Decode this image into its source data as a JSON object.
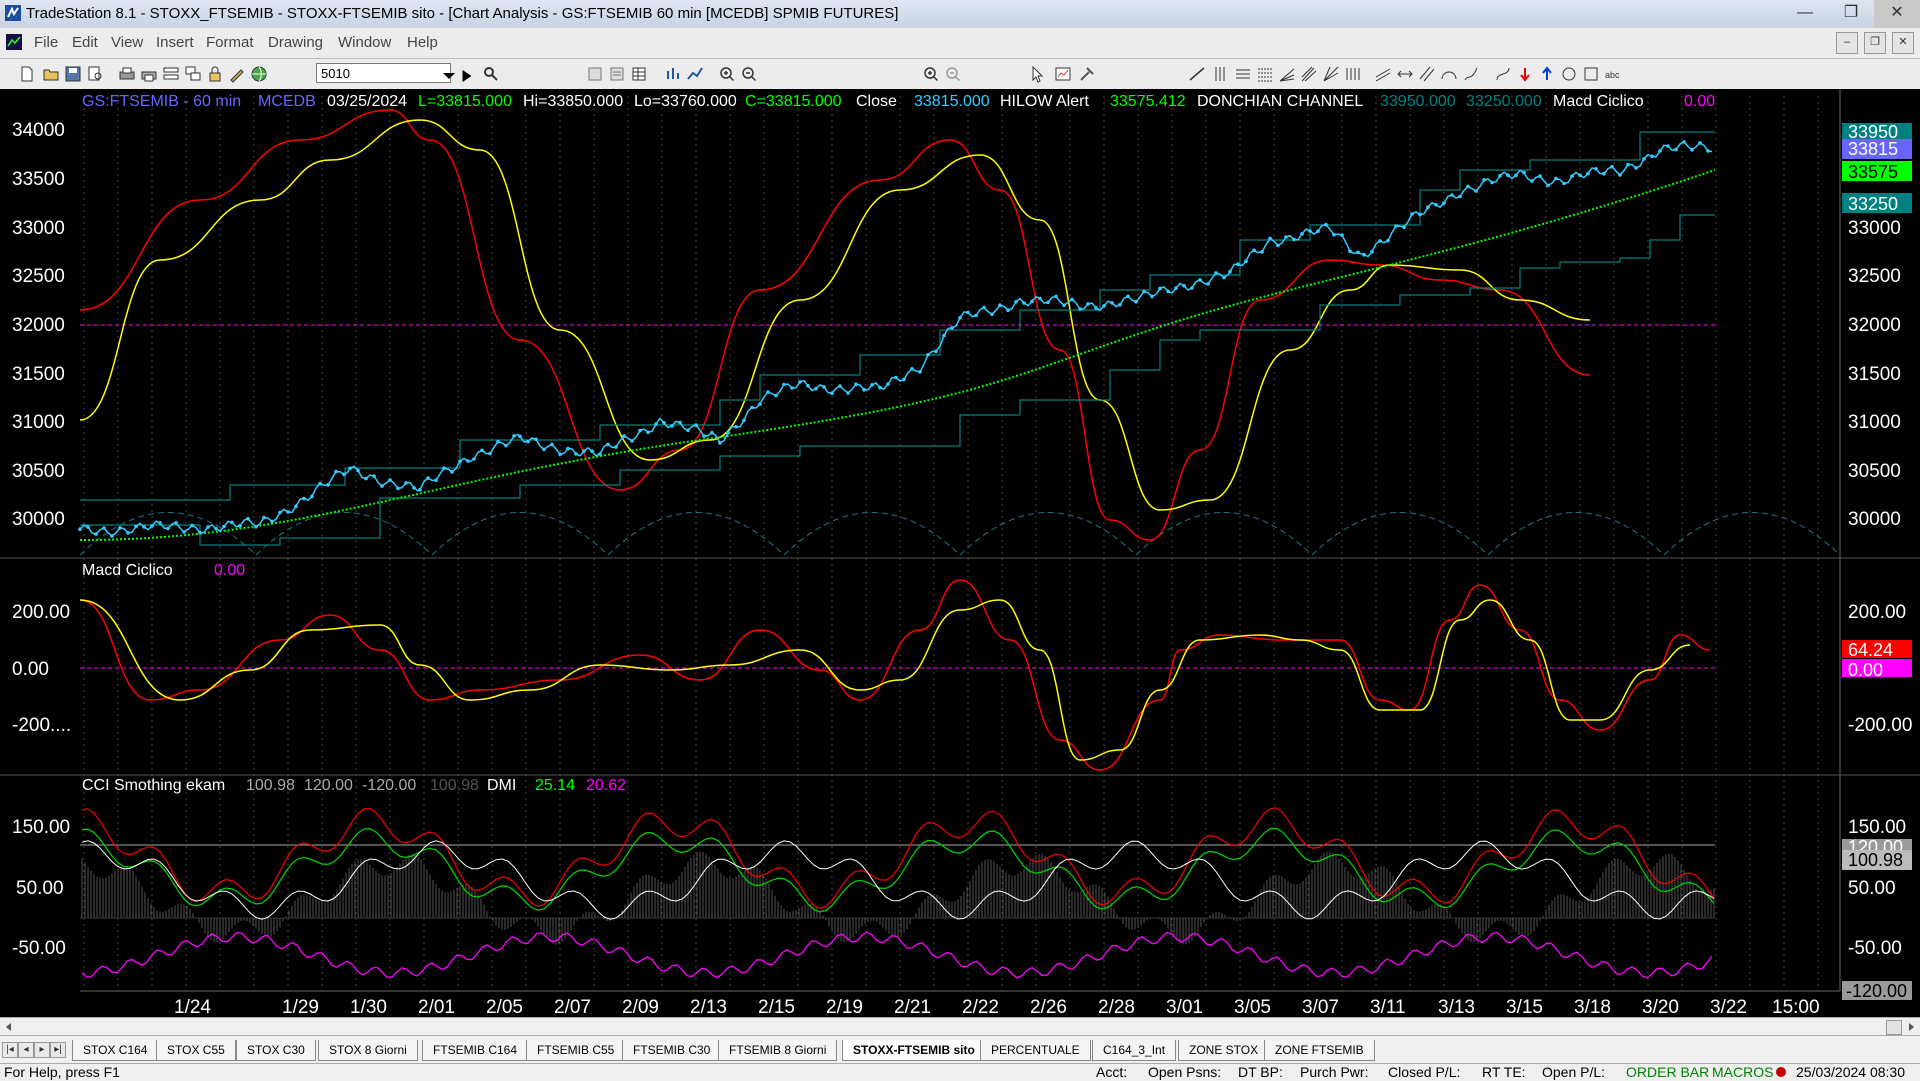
{
  "window": {
    "title": "TradeStation 8.1 - STOXX_FTSEMIB - STOXX-FTSEMIB sito - [Chart Analysis - GS:FTSEMIB  60 min  [MCEDB] SPMIB FUTURES]",
    "minimize": "—",
    "restore": "❐",
    "close": "✕"
  },
  "menu": [
    "File",
    "Edit",
    "View",
    "Insert",
    "Format",
    "Drawing",
    "Window",
    "Help"
  ],
  "mdi_buttons": [
    "–",
    "❐",
    "✕"
  ],
  "toolbar": {
    "symbol_value": "5010"
  },
  "chart": {
    "price_header": {
      "symbol": "GS:FTSEMIB - 60 min",
      "feed": "MCEDB",
      "date": "03/25/2024",
      "last": "L=33815.000",
      "hi": "Hi=33850.000",
      "lo": "Lo=33760.000",
      "close_c": "C=33815.000",
      "close_label": "Close",
      "close_value": "33815.000",
      "hilow_label": "HILOW Alert",
      "hilow_value": "33575.412",
      "donchian_label": "DONCHIAN CHANNEL",
      "donchian_hi": "33950.000",
      "donchian_lo": "33250.000",
      "macd_label": "Macd Ciclico",
      "macd_value": "0.00"
    },
    "price_axis": [
      "34000",
      "33500",
      "33000",
      "32500",
      "32000",
      "31500",
      "31000",
      "30500",
      "30000"
    ],
    "price_axis_right": [
      "33000",
      "32500",
      "32000",
      "31500",
      "31000",
      "30500",
      "30000"
    ],
    "price_tags": [
      {
        "text": "33950",
        "color": "#008080"
      },
      {
        "text": "33815",
        "color": "#6666ff"
      },
      {
        "text": "33575",
        "color": "#00ff00"
      },
      {
        "text": "33250",
        "color": "#008080"
      }
    ],
    "macd_panel": {
      "label": "Macd Ciclico",
      "value": "0.00",
      "axis": [
        "200.00",
        "0.00",
        "-200...."
      ],
      "axis_right": [
        "200.00",
        "-200.00"
      ],
      "tags": [
        {
          "text": "64.24",
          "color": "#ff0000"
        },
        {
          "text": "0.00",
          "color": "#ff00ff"
        }
      ]
    },
    "cci_panel": {
      "label": "CCI Smothing ekam",
      "v1": "100.98",
      "v2": "120.00",
      "v3": "-120.00",
      "v4": "100.98",
      "dmi_label": "DMI",
      "dmi_plus": "25.14",
      "dmi_minus": "20.62",
      "axis": [
        "150.00",
        "50.00",
        "-50.00"
      ],
      "axis_right": [
        "150.00",
        "50.00",
        "-50.00"
      ],
      "tags": [
        {
          "text": "120.00",
          "color": "#bbbbbb"
        },
        {
          "text": "100.98",
          "color": "#ffffff"
        },
        {
          "text": "-120.00",
          "color": "#bbbbbb"
        }
      ]
    },
    "date_axis": [
      "1/24",
      "1/29",
      "1/30",
      "2/01",
      "2/05",
      "2/07",
      "2/09",
      "2/13",
      "2/15",
      "2/19",
      "2/21",
      "2/22",
      "2/26",
      "2/28",
      "3/01",
      "3/05",
      "3/07",
      "3/11",
      "3/13",
      "3/15",
      "3/18",
      "3/20",
      "3/22",
      "15:00"
    ],
    "colors": {
      "price": "#33ccff",
      "hilow": "#00ff00",
      "donchian": "#008080",
      "red": "#ff0000",
      "yellow": "#ffff00",
      "magenta": "#ff00ff",
      "cci_green": "#00cc00",
      "cci_red": "#ff0000",
      "cci_white": "#ffffff"
    }
  },
  "tabs": [
    "STOX C164",
    "STOX C55",
    "STOX  C30",
    "STOX  8 Giorni",
    "FTSEMIB C164",
    "FTSEMIB C55",
    "FTSEMIB C30",
    "FTSEMIB  8 Giorni",
    "STOXX-FTSEMIB sito",
    "PERCENTUALE",
    "C164_3_Int",
    "ZONE STOX",
    "ZONE FTSEMIB"
  ],
  "active_tab": "STOXX-FTSEMIB sito",
  "status": {
    "help": "For Help, press F1",
    "acct": "Acct:",
    "open_psns": "Open Psns:",
    "dt_bp": "DT BP:",
    "purch_pwr": "Purch Pwr:",
    "closed_pl": "Closed P/L:",
    "rt_te": "RT TE:",
    "open_pl": "Open P/L:",
    "order_bar": "ORDER BAR",
    "macros": "MACROS",
    "datetime": "25/03/2024 08:30"
  }
}
